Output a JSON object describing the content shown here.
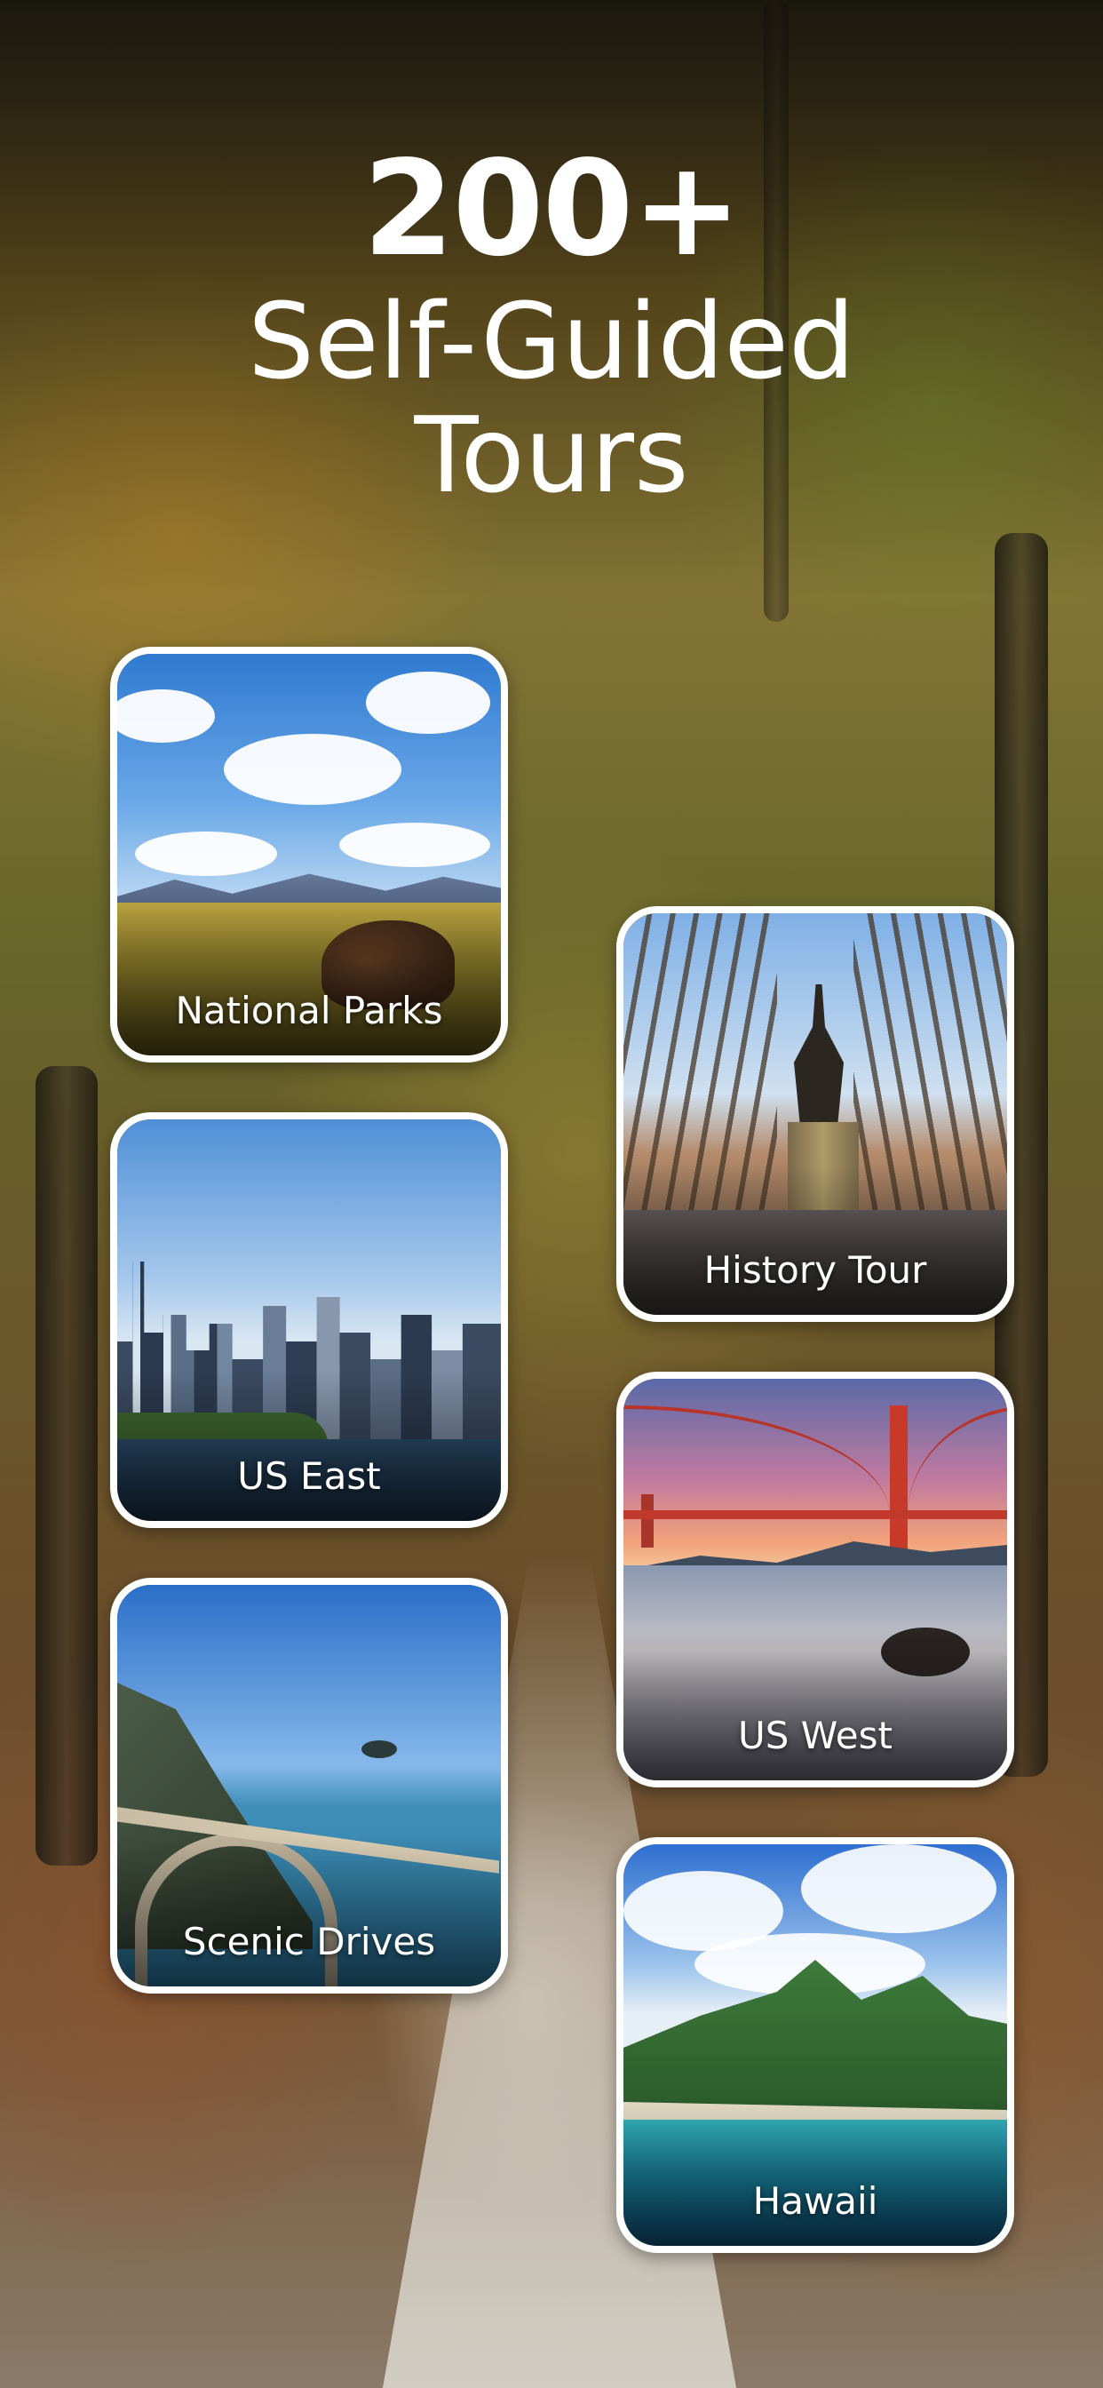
{
  "headline": {
    "count": "200+",
    "line1": "Self-Guided",
    "line2": "Tours"
  },
  "cards": [
    {
      "id": "national-parks",
      "label": "National Parks"
    },
    {
      "id": "history-tour",
      "label": "History Tour"
    },
    {
      "id": "us-east",
      "label": "US East"
    },
    {
      "id": "us-west",
      "label": "US West"
    },
    {
      "id": "scenic-drives",
      "label": "Scenic Drives"
    },
    {
      "id": "hawaii",
      "label": "Hawaii"
    }
  ],
  "colors": {
    "text": "#ffffff",
    "card_border": "#ffffff"
  }
}
